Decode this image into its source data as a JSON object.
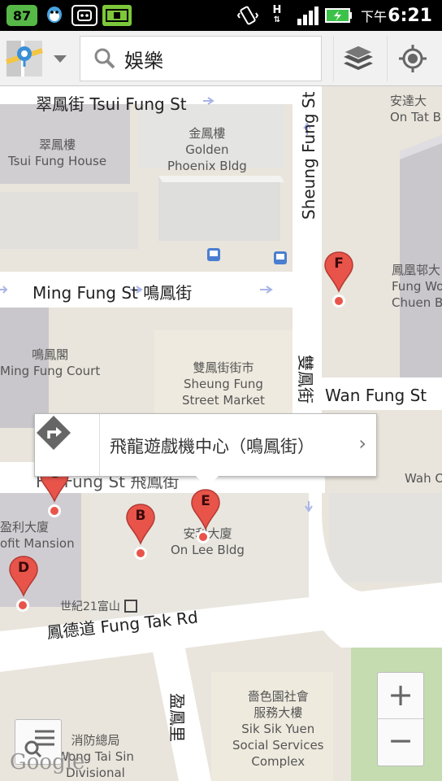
{
  "status_bar": {
    "badge_count": "87",
    "data_label": "H",
    "ampm": "下午",
    "time": "6:21"
  },
  "toolbar": {
    "search_query": "娛樂",
    "icons": [
      "maps-app-icon",
      "dropdown-icon",
      "search-icon",
      "layers-icon",
      "my-location-icon"
    ]
  },
  "map": {
    "roads": {
      "tsui_fung": "翠鳳街   Tsui Fung St",
      "sheung_fung": "Sheung Fung St",
      "ming_fung": "Ming Fung St   鳴鳳街",
      "wan_fung": "Wan Fung St",
      "sheung_fung_cn": "雙鳳街",
      "fei_fung": "Fei Fung St   飛鳳街",
      "fung_tak": "鳳德道  Fung Tak Rd",
      "ying_fung": "盈鳳里"
    },
    "buildings": {
      "tsui_fung_house_cn": "翠鳳樓",
      "tsui_fung_house_en": "Tsui Fung House",
      "golden_phoenix_cn": "金鳳樓",
      "golden_phoenix_en1": "Golden",
      "golden_phoenix_en2": "Phoenix Bldg",
      "on_tat_cn": "安達大",
      "on_tat_en": "On Tat B",
      "fung_wo_cn": "鳳凰邨大",
      "fung_wo_en1": "Fung Wo",
      "fung_wo_en2": "Chuen B",
      "ming_fung_court_cn": "鳴鳳閣",
      "ming_fung_court_en": "Ming Fung Court",
      "market_cn": "雙鳳街街市",
      "market_en1": "Sheung Fung",
      "market_en2": "Street Market",
      "wah_o": "Wah O",
      "profit_mansion_cn": "盈利大廈",
      "profit_mansion_en": "ofit Mansion",
      "on_lee_cn": "安利大廈",
      "on_lee_en": "On Lee Bldg",
      "century21": "世紀21富山",
      "sik_sik_cn1": "嗇色園社會",
      "sik_sik_cn2": "服務大樓",
      "sik_sik_en1": "Sik Sik Yuen",
      "sik_sik_en2": "Social Services",
      "sik_sik_en3": "Complex",
      "fire_cn": "消防總局",
      "fire_en1": "Wong Tai Sin",
      "fire_en2": "Divisional"
    },
    "markers": [
      "F",
      "G",
      "B",
      "E",
      "D"
    ],
    "callout": {
      "title": "飛龍遊戲機中心（鳴鳳街）",
      "arrow": "›"
    },
    "zoom": {
      "in": "+",
      "out": "−"
    },
    "attribution": "Google"
  },
  "colors": {
    "marker_red": "#e8544a",
    "road": "#ffffff",
    "park": "#c5dcb0"
  }
}
